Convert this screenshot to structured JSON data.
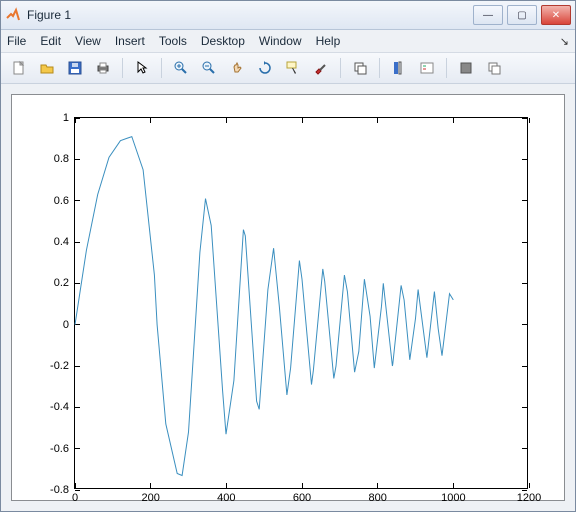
{
  "window": {
    "title": "Figure 1",
    "close_glyph": "✕",
    "min_glyph": "—",
    "max_glyph": "▢"
  },
  "menubar": {
    "items": [
      "File",
      "Edit",
      "View",
      "Insert",
      "Tools",
      "Desktop",
      "Window",
      "Help"
    ],
    "dock_glyph": "↘"
  },
  "toolbar": {
    "icons": [
      {
        "name": "new-file-icon",
        "title": "New"
      },
      {
        "name": "open-icon",
        "title": "Open"
      },
      {
        "name": "save-icon",
        "title": "Save"
      },
      {
        "name": "print-icon",
        "title": "Print"
      },
      {
        "sep": true
      },
      {
        "name": "pointer-icon",
        "title": "Edit Plot"
      },
      {
        "sep": true
      },
      {
        "name": "zoom-in-icon",
        "title": "Zoom In"
      },
      {
        "name": "zoom-out-icon",
        "title": "Zoom Out"
      },
      {
        "name": "pan-icon",
        "title": "Pan"
      },
      {
        "name": "rotate-icon",
        "title": "Rotate"
      },
      {
        "name": "datacursor-icon",
        "title": "Data Cursor"
      },
      {
        "name": "brush-icon",
        "title": "Brush"
      },
      {
        "sep": true
      },
      {
        "name": "link-icon",
        "title": "Link"
      },
      {
        "sep": true
      },
      {
        "name": "colorbar-icon",
        "title": "Colorbar"
      },
      {
        "name": "legend-icon",
        "title": "Legend"
      },
      {
        "sep": true
      },
      {
        "name": "annotation-icon",
        "title": "Hide Tools"
      },
      {
        "name": "copy-icon",
        "title": "Copy"
      }
    ]
  },
  "chart_data": {
    "type": "line",
    "title": "",
    "xlabel": "",
    "ylabel": "",
    "xlim": [
      0,
      1200
    ],
    "ylim": [
      -0.8,
      1.0
    ],
    "xticks": [
      0,
      200,
      400,
      600,
      800,
      1000,
      1200
    ],
    "yticks": [
      -0.8,
      -0.6,
      -0.4,
      -0.2,
      0,
      0.2,
      0.4,
      0.6,
      0.8,
      1.0
    ],
    "data_description": "Damped chirp: amplitude decays roughly as 1/sqrt(x) while frequency increases; starts at 0, rises to peak ~0.91 near x=150, then oscillates with shrinking amplitude and shortening period out to x=1000.",
    "x": [
      0,
      30,
      60,
      90,
      120,
      150,
      180,
      210,
      217,
      240,
      270,
      283,
      300,
      330,
      345,
      360,
      390,
      399,
      420,
      445,
      450,
      480,
      487,
      510,
      525,
      540,
      560,
      570,
      593,
      600,
      625,
      630,
      655,
      660,
      684,
      690,
      712,
      720,
      739,
      750,
      765,
      780,
      791,
      810,
      815,
      839,
      840,
      862,
      870,
      885,
      900,
      907,
      930,
      950,
      960,
      970,
      990,
      1000
    ],
    "y": [
      0.0,
      0.36,
      0.63,
      0.81,
      0.89,
      0.91,
      0.75,
      0.24,
      0.0,
      -0.48,
      -0.72,
      -0.73,
      -0.52,
      0.35,
      0.61,
      0.48,
      -0.32,
      -0.53,
      -0.27,
      0.46,
      0.43,
      -0.37,
      -0.41,
      0.17,
      0.37,
      0.09,
      -0.34,
      -0.21,
      0.31,
      0.22,
      -0.29,
      -0.22,
      0.27,
      0.21,
      -0.26,
      -0.2,
      0.24,
      0.16,
      -0.23,
      -0.13,
      0.22,
      0.04,
      -0.21,
      0.09,
      0.2,
      -0.2,
      -0.19,
      0.19,
      0.12,
      -0.17,
      0.03,
      0.17,
      -0.16,
      0.16,
      -0.02,
      -0.15,
      0.15,
      0.12
    ]
  },
  "axis_tick_labels": {
    "x": [
      "0",
      "200",
      "400",
      "600",
      "800",
      "1000",
      "1200"
    ],
    "y": [
      "-0.8",
      "-0.6",
      "-0.4",
      "-0.2",
      "0",
      "0.2",
      "0.4",
      "0.6",
      "0.8",
      "1"
    ]
  }
}
